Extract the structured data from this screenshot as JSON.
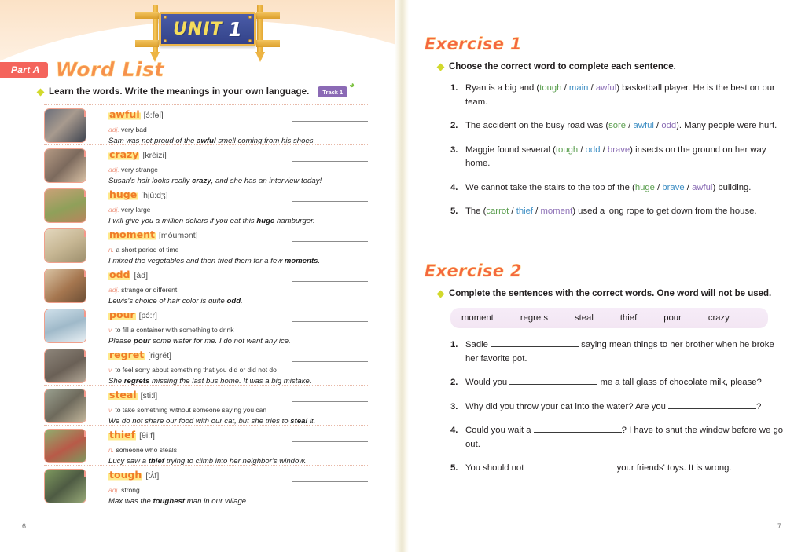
{
  "unit": {
    "word": "UNIT",
    "number": "1"
  },
  "left_page": {
    "part_label": "Part A",
    "section_title": "Word List",
    "instruction": "Learn the words. Write the meanings in your own language.",
    "track_badge": "Track 1",
    "page_number": "6",
    "words": [
      {
        "num": "721",
        "word": "awful",
        "phonetic": "[ɔ́:fəl]",
        "pos": "adj.",
        "definition": "very bad",
        "example_pre": "Sam was not proud of the ",
        "example_bold": "awful",
        "example_post": " smell coming from his shoes."
      },
      {
        "num": "722",
        "word": "crazy",
        "phonetic": "[kréizi]",
        "pos": "adj.",
        "definition": "very strange",
        "example_pre": "Susan's hair looks really ",
        "example_bold": "crazy",
        "example_post": ", and she has an interview today!"
      },
      {
        "num": "723",
        "word": "huge",
        "phonetic": "[hjú:dʒ]",
        "pos": "adj.",
        "definition": "very large",
        "example_pre": "I will give you a million dollars if you eat this ",
        "example_bold": "huge",
        "example_post": " hamburger."
      },
      {
        "num": "724",
        "word": "moment",
        "phonetic": "[móumənt]",
        "pos": "n.",
        "definition": "a short period of time",
        "example_pre": "I mixed the vegetables and then fried them for a few ",
        "example_bold": "moments",
        "example_post": "."
      },
      {
        "num": "725",
        "word": "odd",
        "phonetic": "[ád]",
        "pos": "adj.",
        "definition": "strange or different",
        "example_pre": "Lewis's choice of hair color is quite ",
        "example_bold": "odd",
        "example_post": "."
      },
      {
        "num": "726",
        "word": "pour",
        "phonetic": "[pɔ́:r]",
        "pos": "v.",
        "definition": "to fill a container with something to drink",
        "example_pre": "Please ",
        "example_bold": "pour",
        "example_post": " some water for me. I do not want any ice."
      },
      {
        "num": "727",
        "word": "regret",
        "phonetic": "[rigrét]",
        "pos": "v.",
        "definition": "to feel sorry about something that you did or did not do",
        "example_pre": "She ",
        "example_bold": "regrets",
        "example_post": " missing the last bus home. It was a big mistake."
      },
      {
        "num": "728",
        "word": "steal",
        "phonetic": "[sti:l]",
        "pos": "v.",
        "definition": "to take something without someone saying you can",
        "example_pre": "We do not share our food with our cat, but she tries to ",
        "example_bold": "steal",
        "example_post": " it."
      },
      {
        "num": "729",
        "word": "thief",
        "phonetic": "[θi:f]",
        "pos": "n.",
        "definition": "someone who steals",
        "example_pre": "Lucy saw a ",
        "example_bold": "thief",
        "example_post": " trying to climb into her neighbor's window."
      },
      {
        "num": "730",
        "word": "tough",
        "phonetic": "[tʌ́f]",
        "pos": "adj.",
        "definition": "strong",
        "example_pre": "Max was the ",
        "example_bold": "toughest",
        "example_post": " man in our village."
      }
    ]
  },
  "right_page": {
    "page_number": "7",
    "exercise_1": {
      "title": "Exercise 1",
      "instruction": "Choose the correct word to complete each sentence.",
      "questions": [
        {
          "num": "1.",
          "pre": "Ryan is a big and (",
          "opt_a": "tough",
          "opt_b": "main",
          "opt_c": "awful",
          "post": ") basketball player. He is the best on our team."
        },
        {
          "num": "2.",
          "pre": "The accident on the busy road was (",
          "opt_a": "sore",
          "opt_b": "awful",
          "opt_c": "odd",
          "post": "). Many people were hurt."
        },
        {
          "num": "3.",
          "pre": "Maggie found several (",
          "opt_a": "tough",
          "opt_b": "odd",
          "opt_c": "brave",
          "post": ") insects on the ground on her way home."
        },
        {
          "num": "4.",
          "pre": "We cannot take the stairs to the top of the (",
          "opt_a": "huge",
          "opt_b": "brave",
          "opt_c": "awful",
          "post": ") building."
        },
        {
          "num": "5.",
          "pre": "The (",
          "opt_a": "carrot",
          "opt_b": "thief",
          "opt_c": "moment",
          "post": ") used a long rope to get down from the house."
        }
      ]
    },
    "exercise_2": {
      "title": "Exercise 2",
      "instruction": "Complete the sentences with the correct words. One word will not be used.",
      "word_bank": [
        "moment",
        "regrets",
        "steal",
        "thief",
        "pour",
        "crazy"
      ],
      "questions": [
        {
          "num": "1.",
          "pre": "Sadie ",
          "post": " saying mean things to her brother when he broke her favorite pot."
        },
        {
          "num": "2.",
          "pre": "Would you ",
          "post": " me a tall glass of chocolate milk, please?"
        },
        {
          "num": "3.",
          "pre": "Why did you throw your cat into the water? Are you ",
          "post": "?"
        },
        {
          "num": "4.",
          "pre": "Could you wait a ",
          "post": "? I have to shut the window before we go out."
        },
        {
          "num": "5.",
          "pre": "You should not ",
          "post": " your friends' toys. It is wrong."
        }
      ]
    }
  }
}
